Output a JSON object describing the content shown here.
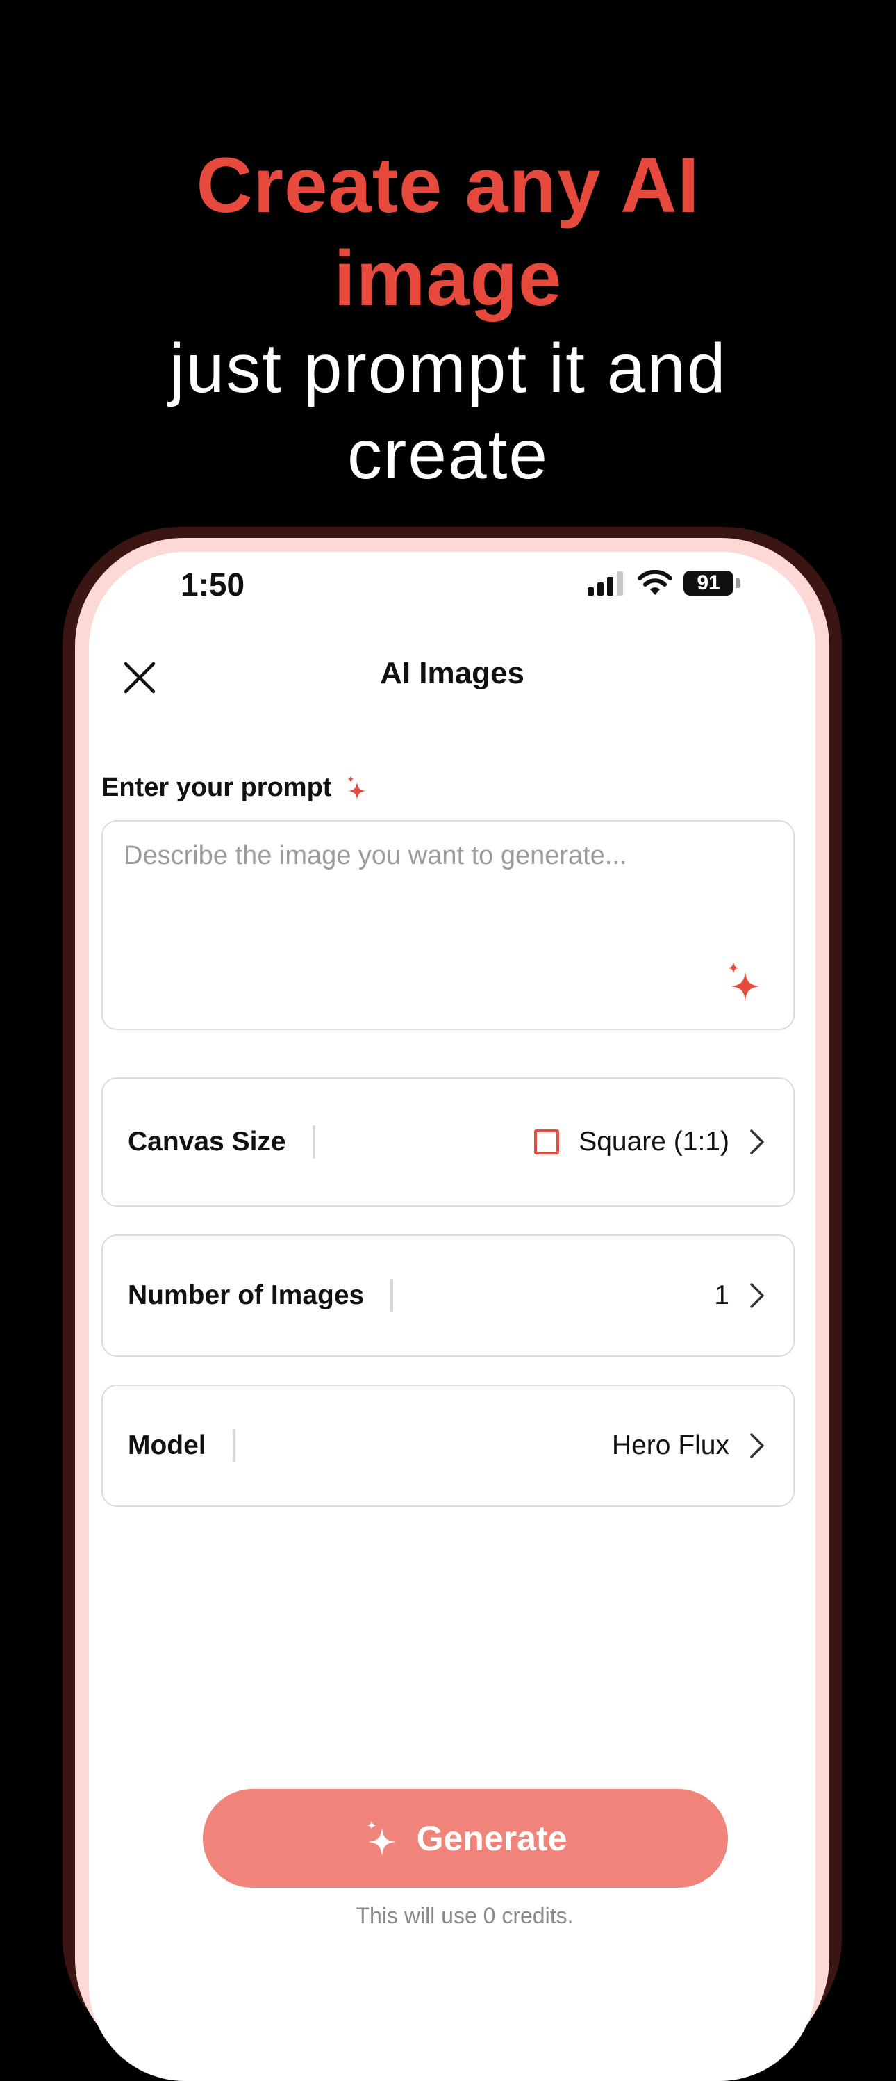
{
  "headline": {
    "line1": "Create any AI",
    "line2": "image",
    "line3": "just prompt it and",
    "line4": "create"
  },
  "status_bar": {
    "time": "1:50",
    "battery": "91",
    "icons": [
      "cellular-signal-icon",
      "wifi-icon",
      "battery-icon"
    ]
  },
  "nav": {
    "title": "AI Images",
    "close_icon": "close-icon"
  },
  "prompt": {
    "label": "Enter your prompt",
    "placeholder": "Describe the image you want to generate...",
    "value": "",
    "label_icon": "sparkle-icon",
    "enhance_icon": "sparkle-icon"
  },
  "options": {
    "canvas_size": {
      "label": "Canvas Size",
      "value": "Square (1:1)",
      "icon": "square-icon"
    },
    "number_of_images": {
      "label": "Number of Images",
      "value": "1"
    },
    "model": {
      "label": "Model",
      "value": "Hero Flux"
    }
  },
  "generate": {
    "label": "Generate",
    "credits_note": "This will use 0 credits."
  },
  "colors": {
    "accent": "#E8493D",
    "button": "#F0847A",
    "background": "#000000",
    "phone_rim": "#FCD9D4",
    "phone_frame": "#3A1512"
  }
}
